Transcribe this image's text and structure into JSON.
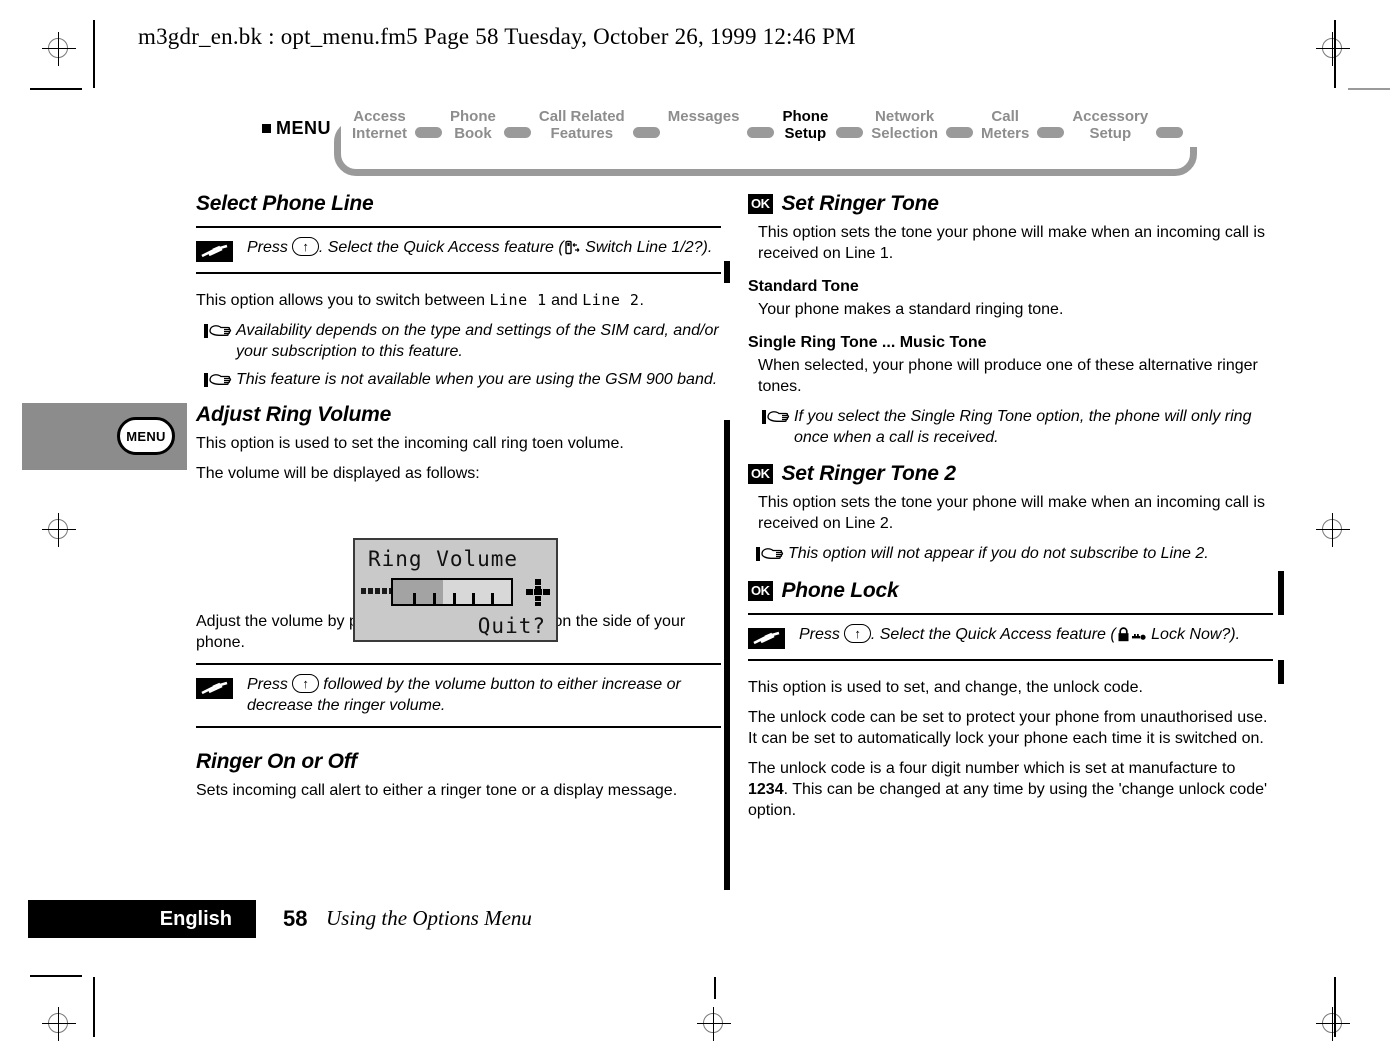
{
  "header": {
    "text": "m3gdr_en.bk : opt_menu.fm5  Page 58  Tuesday, October 26, 1999  12:46 PM"
  },
  "nav": {
    "menu_label": "MENU",
    "items": [
      {
        "line1": "Access",
        "line2": "Internet",
        "active": false
      },
      {
        "line1": "Phone",
        "line2": "Book",
        "active": false
      },
      {
        "line1": "Call Related",
        "line2": "Features",
        "active": false
      },
      {
        "line1": "Messages",
        "line2": "",
        "active": false
      },
      {
        "line1": "Phone",
        "line2": "Setup",
        "active": true
      },
      {
        "line1": "Network",
        "line2": "Selection",
        "active": false
      },
      {
        "line1": "Call",
        "line2": "Meters",
        "active": false
      },
      {
        "line1": "Accessory",
        "line2": "Setup",
        "active": false
      }
    ]
  },
  "side_tab": {
    "button_label": "MENU"
  },
  "left_column": {
    "heading_select_phone_line": "Select Phone Line",
    "tip_select_line": {
      "press": "Press",
      "key": "↑",
      "after_key": ". Select the Quick Access feature (",
      "icon_name": "switch-line-icon",
      "feature": " Switch Line 1/2?)."
    },
    "switch_intro_a": "This option allows you to switch between ",
    "switch_mono_1": "Line 1",
    "switch_intro_b": " and ",
    "switch_mono_2": "Line 2",
    "switch_intro_c": ".",
    "note_sim": "Availability depends on the type and settings of the SIM card, and/or your subscription to this feature.",
    "note_gsm": "This feature is not available when you are using the GSM 900 band.",
    "heading_adjust_ring_volume": "Adjust Ring Volume",
    "adjust_p1": "This option is used to set the incoming call ring toen volume.",
    "adjust_p2": "The volume will be displayed as follows:",
    "lcd": {
      "title": "Ring Volume",
      "quit": "Quit?",
      "fill_percent": 42
    },
    "adjust_p3": "Adjust the volume by pressing the volume buttons on the side of your phone.",
    "tip_volume": {
      "press": "Press",
      "key": "↑",
      "after_key": " followed by the volume button to either increase or decrease the ringer volume."
    },
    "heading_ringer_on_off": "Ringer On or Off",
    "ringer_p1": "Sets incoming call alert to either a ringer tone or a display message."
  },
  "right_column": {
    "heading_set_ringer_tone": "Set Ringer Tone",
    "ok_badge": "OK",
    "ringer_tone_p1": "This option sets the tone your phone will make when an incoming call is received on Line 1.",
    "sub_standard_tone": "Standard Tone",
    "standard_tone_p": "Your phone makes a standard ringing tone.",
    "sub_single_ring_tone": "Single Ring Tone ... Music Tone",
    "single_ring_p": "When selected, your phone will produce one of these alternative ringer tones.",
    "note_single_ring": "If you select the Single Ring Tone option, the phone will only ring once when a call is received.",
    "heading_set_ringer_tone_2": "Set Ringer Tone 2",
    "ringer_tone2_p1": "This option sets the tone your phone will make when an incoming call is received on Line 2.",
    "note_line2": "This option will not appear if you do not subscribe to Line 2.",
    "heading_phone_lock": "Phone Lock",
    "tip_phone_lock": {
      "press": "Press",
      "key": "↑",
      "after_key": ". Select the Quick Access feature (",
      "icon_name": "padlock-key-icon",
      "feature": " Lock Now?)."
    },
    "lock_p1": "This option is used to set, and change, the unlock code.",
    "lock_p2": "The unlock code can be set to protect your phone from unauthorised use. It can be set to automatically lock your phone each time it is switched on.",
    "lock_p3a": "The unlock code is a four digit number which is set at manufacture to ",
    "lock_code": "1234",
    "lock_p3b": ". This can be changed at any time by using the 'change unlock code' option."
  },
  "footer": {
    "language": "English",
    "page_number": "58",
    "title": "Using the Options Menu"
  },
  "colors": {
    "nav_inactive": "#8d8d8d",
    "nav_active": "#000000",
    "side_tab": "#8c8c8c",
    "lcd_background": "#c9c9c9",
    "lcd_fill": "#a3a3a3"
  }
}
